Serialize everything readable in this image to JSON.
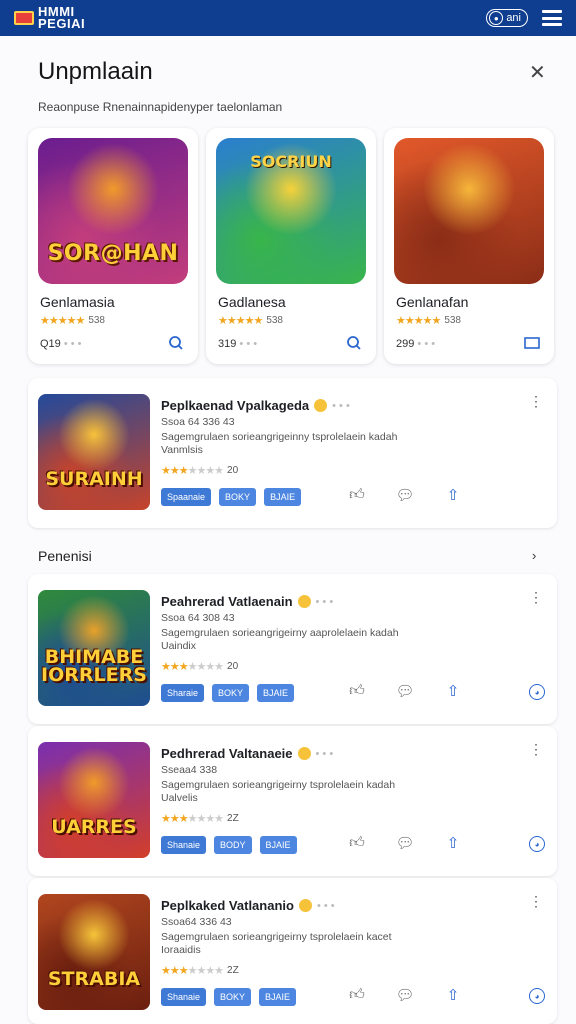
{
  "topbar": {
    "logo": "HMMI PEGIAI",
    "user": "ani"
  },
  "sheet": {
    "title": "Unpmlaain",
    "subtitle": "Reaonpuse Rnenainnapidenyper taelonlaman"
  },
  "featured": [
    {
      "art_text": "SOR@HAN",
      "art_top": "",
      "name": "Genlamasia",
      "stars": 4.5,
      "rating_text": "538",
      "meta": "Q19",
      "action_icon": "search-icon",
      "colors": [
        "#6a1d8f",
        "#c33d7c",
        "#f09a2a"
      ]
    },
    {
      "art_text": "",
      "art_top": "SOCRIUN",
      "name": "Gadlanesa",
      "stars": 4.5,
      "rating_text": "538",
      "meta": "319",
      "action_icon": "search-icon",
      "colors": [
        "#2a7fcf",
        "#38b54a",
        "#f6d23a"
      ]
    },
    {
      "art_text": "",
      "art_top": "",
      "name": "Genlanafan",
      "stars": 4.5,
      "rating_text": "538",
      "meta": "299",
      "action_icon": "square-icon",
      "colors": [
        "#e2592a",
        "#8b2d17",
        "#f6b63a"
      ]
    }
  ],
  "section_label": "Penenisi",
  "items": [
    {
      "art_text": "SURAINH",
      "title": "Peplkaenad Vpalkageda",
      "line1": "Ssoa 64 336 43",
      "desc": "Sagemgrulaen sorieangrigeinny tsprolelaein kadah Vanmlsis",
      "stars": 2.5,
      "rating_text": "20",
      "chips": [
        "Spaanaie",
        "BOKY",
        "BJAIE"
      ],
      "extra": false,
      "colors": [
        "#234a9a",
        "#c7432a",
        "#f7c23a"
      ]
    },
    {
      "art_text": "BHIMABE IORRLERS",
      "title": "Peahrerad Vatlaenain",
      "line1": "Ssoa 64 308 43",
      "desc": "Sagemgrulaen sorieangrigeirny aaprolelaein kadah Uaindix",
      "stars": 2.5,
      "rating_text": "20",
      "chips": [
        "Sharaie",
        "BOKY",
        "BJAIE"
      ],
      "extra": true,
      "colors": [
        "#2f8a3a",
        "#1f4c92",
        "#e8a12a"
      ]
    },
    {
      "art_text": "UARRES",
      "title": "Pedhrerad Valtanaeie",
      "line1": "Sseaa4 338",
      "desc": "Sagemgrulaen sorieangrigeirny tsprolelaein kadah Ualvelis",
      "stars": 2.5,
      "rating_text": "2Z",
      "chips": [
        "Shanaie",
        "BODY",
        "BJAIE"
      ],
      "extra": true,
      "colors": [
        "#7a2fb0",
        "#d23e2a",
        "#f09a2a"
      ]
    },
    {
      "art_text": "STRABIA",
      "title": "Peplkaked Vatlananio",
      "line1": "Ssoa64 336 43",
      "desc": "Sagemgrulaen sorieangrigeirny tsprolelaein kacet Ioraaidis",
      "stars": 2.5,
      "rating_text": "2Z",
      "chips": [
        "Shanaie",
        "BOKY",
        "BJAIE"
      ],
      "extra": true,
      "colors": [
        "#b0461f",
        "#6b1f0f",
        "#f6c43a"
      ]
    }
  ]
}
